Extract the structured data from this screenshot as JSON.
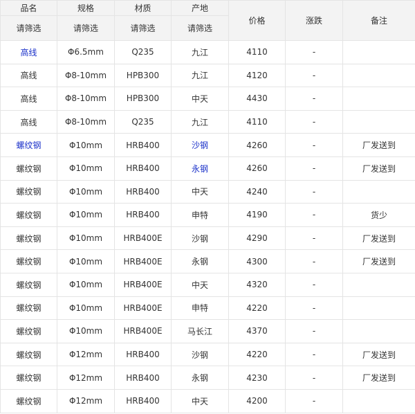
{
  "colors": {
    "link": "#1a30c9",
    "header_bg": "#f3f3f3",
    "border": "#e4e4e4"
  },
  "header": {
    "name": "品名",
    "spec": "规格",
    "material": "材质",
    "origin": "产地",
    "price": "价格",
    "change": "涨跌",
    "note": "备注",
    "name_filter": "请筛选",
    "spec_filter": "请筛选",
    "material_filter": "请筛选",
    "origin_filter": "请筛选"
  },
  "rows": [
    {
      "name": "高线",
      "spec": "Φ6.5mm",
      "material": "Q235",
      "origin": "九江",
      "price": "4110",
      "change": "-",
      "note": ""
    },
    {
      "name": "高线",
      "spec": "Φ8-10mm",
      "material": "HPB300",
      "origin": "九江",
      "price": "4120",
      "change": "-",
      "note": ""
    },
    {
      "name": "高线",
      "spec": "Φ8-10mm",
      "material": "HPB300",
      "origin": "中天",
      "price": "4430",
      "change": "-",
      "note": ""
    },
    {
      "name": "高线",
      "spec": "Φ8-10mm",
      "material": "Q235",
      "origin": "九江",
      "price": "4110",
      "change": "-",
      "note": ""
    },
    {
      "name": "螺纹钢",
      "spec": "Φ10mm",
      "material": "HRB400",
      "origin": "沙钢",
      "price": "4260",
      "change": "-",
      "note": "厂发送到"
    },
    {
      "name": "螺纹钢",
      "spec": "Φ10mm",
      "material": "HRB400",
      "origin": "永钢",
      "price": "4260",
      "change": "-",
      "note": "厂发送到"
    },
    {
      "name": "螺纹钢",
      "spec": "Φ10mm",
      "material": "HRB400",
      "origin": "中天",
      "price": "4240",
      "change": "-",
      "note": ""
    },
    {
      "name": "螺纹钢",
      "spec": "Φ10mm",
      "material": "HRB400",
      "origin": "申特",
      "price": "4190",
      "change": "-",
      "note": "货少"
    },
    {
      "name": "螺纹钢",
      "spec": "Φ10mm",
      "material": "HRB400E",
      "origin": "沙钢",
      "price": "4290",
      "change": "-",
      "note": "厂发送到"
    },
    {
      "name": "螺纹钢",
      "spec": "Φ10mm",
      "material": "HRB400E",
      "origin": "永钢",
      "price": "4300",
      "change": "-",
      "note": "厂发送到"
    },
    {
      "name": "螺纹钢",
      "spec": "Φ10mm",
      "material": "HRB400E",
      "origin": "中天",
      "price": "4320",
      "change": "-",
      "note": ""
    },
    {
      "name": "螺纹钢",
      "spec": "Φ10mm",
      "material": "HRB400E",
      "origin": "申特",
      "price": "4220",
      "change": "-",
      "note": ""
    },
    {
      "name": "螺纹钢",
      "spec": "Φ10mm",
      "material": "HRB400E",
      "origin": "马长江",
      "price": "4370",
      "change": "-",
      "note": ""
    },
    {
      "name": "螺纹钢",
      "spec": "Φ12mm",
      "material": "HRB400",
      "origin": "沙钢",
      "price": "4220",
      "change": "-",
      "note": "厂发送到"
    },
    {
      "name": "螺纹钢",
      "spec": "Φ12mm",
      "material": "HRB400",
      "origin": "永钢",
      "price": "4230",
      "change": "-",
      "note": "厂发送到"
    },
    {
      "name": "螺纹钢",
      "spec": "Φ12mm",
      "material": "HRB400",
      "origin": "中天",
      "price": "4200",
      "change": "-",
      "note": ""
    }
  ]
}
